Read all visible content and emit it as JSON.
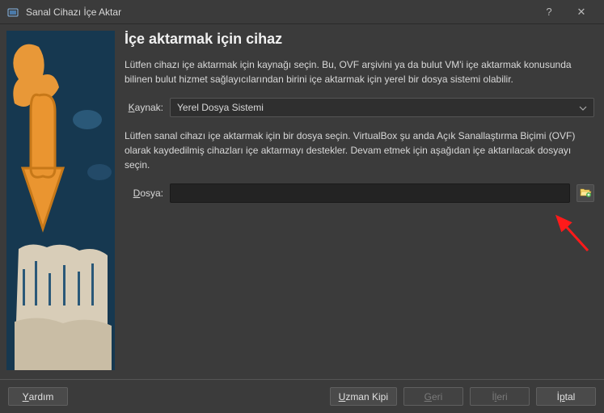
{
  "window": {
    "title": "Sanal Cihazı İçe Aktar",
    "help": "?",
    "close": "✕"
  },
  "page": {
    "heading": "İçe aktarmak için cihaz",
    "intro": "Lütfen cihazı içe aktarmak için kaynağı seçin. Bu, OVF arşivini ya da bulut VM'i içe aktarmak konusunda bilinen bulut hizmet sağlayıcılarından birini içe aktarmak için yerel bir dosya sistemi olabilir.",
    "sourceLabel": "Kaynak:",
    "sourceValue": "Yerel Dosya Sistemi",
    "fileHelp": "Lütfen sanal cihazı içe aktarmak için bir dosya seçin. VirtualBox şu anda Açık Sanallaştırma Biçimi (OVF) olarak kaydedilmiş cihazları içe aktarmayı destekler. Devam etmek için aşağıdan içe aktarılacak dosyayı seçin.",
    "fileLabel": "Dosya:",
    "fileValue": ""
  },
  "footer": {
    "help": "Yardım",
    "expert": "Uzman Kipi",
    "back": "Geri",
    "next": "İleri",
    "cancel": "İptal"
  }
}
